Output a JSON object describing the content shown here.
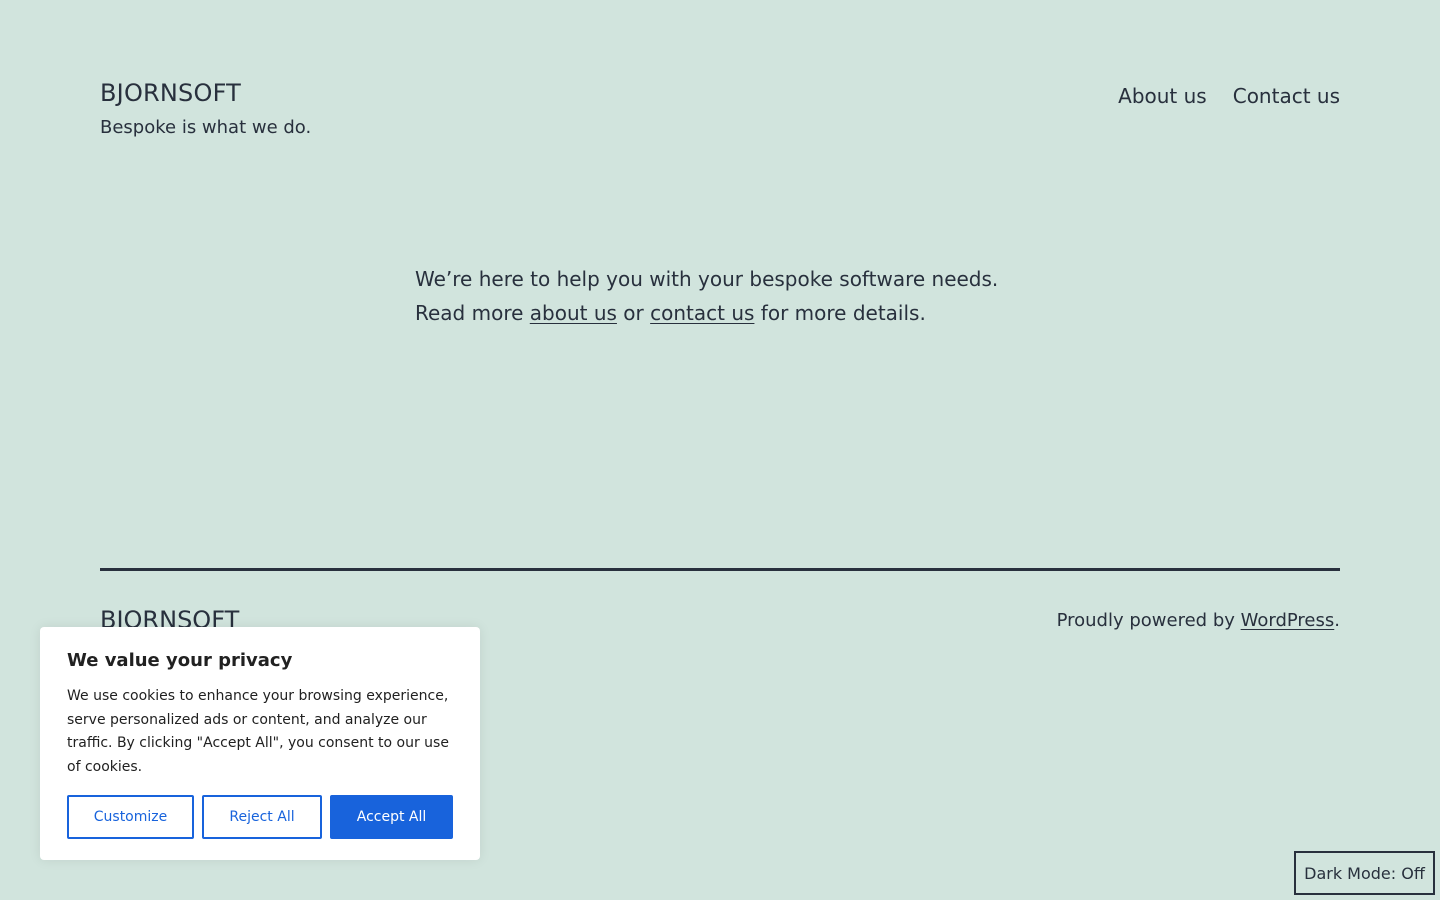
{
  "header": {
    "site_title": "BJORNSOFT",
    "tagline": "Bespoke is what we do.",
    "nav": [
      {
        "label": "About us"
      },
      {
        "label": "Contact us"
      }
    ]
  },
  "main": {
    "line1": "We’re here to help you with your bespoke software needs.",
    "line2_prefix": "Read more ",
    "about_link": "about us",
    "line2_middle": " or ",
    "contact_link": "contact us",
    "line2_suffix": " for more details."
  },
  "footer": {
    "site_title": "BJORNSOFT",
    "powered_prefix": "Proudly powered by ",
    "powered_link": "WordPress",
    "powered_suffix": "."
  },
  "cookie_banner": {
    "heading": "We value your privacy",
    "text": "We use cookies to enhance your browsing experience, serve personalized ads or content, and analyze our traffic. By clicking \"Accept All\", you consent to our use of cookies.",
    "customize_label": "Customize",
    "reject_label": "Reject All",
    "accept_label": "Accept All"
  },
  "dark_mode_toggle": {
    "label": "Dark Mode: Off"
  },
  "colors": {
    "background": "#d1e4dd",
    "text": "#28303d",
    "accent": "#1863dc",
    "banner_bg": "#ffffff"
  }
}
